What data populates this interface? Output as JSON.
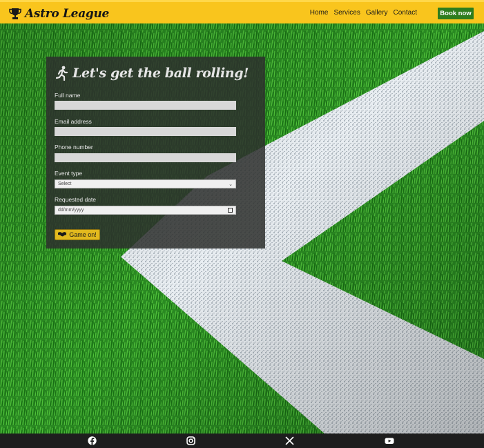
{
  "header": {
    "brand": "Astro League",
    "nav": [
      "Home",
      "Services",
      "Gallery",
      "Contact"
    ],
    "book_button": "Book now"
  },
  "form": {
    "title": "Let's get the ball rolling!",
    "fields": {
      "full_name": {
        "label": "Full name",
        "value": ""
      },
      "email": {
        "label": "Email address",
        "value": ""
      },
      "phone": {
        "label": "Phone number",
        "value": ""
      },
      "event_type": {
        "label": "Event type",
        "selected": "Select"
      },
      "date": {
        "label": "Requested date",
        "placeholder": "dd/mm/yyyy"
      }
    },
    "submit": "Game on!"
  },
  "footer": {
    "social": [
      "facebook-icon",
      "instagram-icon",
      "x-icon",
      "youtube-icon"
    ]
  },
  "colors": {
    "header_bg": "#f9c51d",
    "book_button_bg": "#2e7d1e",
    "submit_bg": "#e2b91e",
    "footer_bg": "#1e1e1e"
  }
}
